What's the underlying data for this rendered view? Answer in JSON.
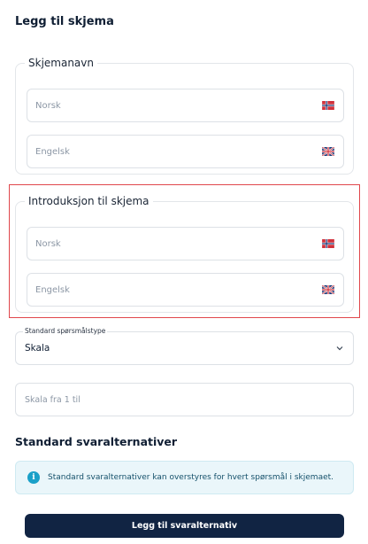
{
  "dialog": {
    "title": "Legg til skjema"
  },
  "schema_name": {
    "legend": "Skjemanavn",
    "norwegian_placeholder": "Norsk",
    "english_placeholder": "Engelsk"
  },
  "schema_intro": {
    "legend": "Introduksjon til skjema",
    "norwegian_placeholder": "Norsk",
    "english_placeholder": "Engelsk"
  },
  "question_type": {
    "label": "Standard spørsmålstype",
    "value": "Skala"
  },
  "scale": {
    "placeholder": "Skala fra 1 til"
  },
  "answer_options": {
    "title": "Standard svaralternativer",
    "info_text": "Standard svaralternativer kan overstyres for hvert spørsmål i skjemaet.",
    "add_button_label": "Legg til svaralternativ"
  },
  "icons": {
    "norwegian_flag": "norway-flag-icon",
    "english_flag": "uk-flag-icon",
    "dropdown": "chevron-down-icon",
    "info": "info-icon"
  },
  "colors": {
    "primary_button": "#112443",
    "highlight_border": "#e0474c",
    "info_background": "#eaf6fa",
    "info_icon": "#1aa0c8"
  }
}
